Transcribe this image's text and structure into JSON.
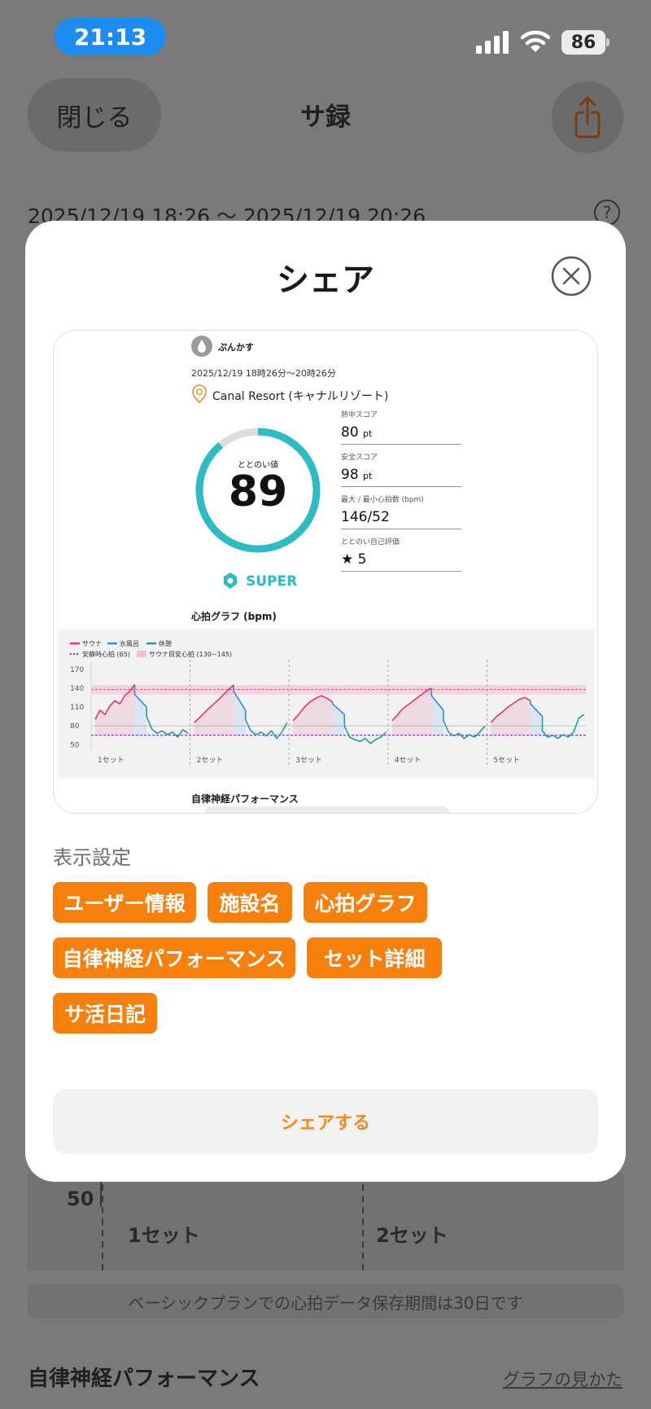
{
  "status_bar": {
    "time": "21:13",
    "battery": "86"
  },
  "nav": {
    "close_label": "閉じる",
    "title": "サ録",
    "share_icon": "share-icon"
  },
  "session": {
    "date_range": "2025/12/19 18:26 〜 2025/12/19 20:26",
    "help": "?"
  },
  "background": {
    "axis_50": "50",
    "set1": "1セット",
    "set2": "2セット",
    "notice": "ベーシックプランでの心拍データ保存期間は30日です",
    "section_title": "自律神経パフォーマンス",
    "graph_link": "グラフの見かた"
  },
  "modal": {
    "title": "シェア",
    "display_settings_label": "表示設定",
    "chips": [
      "ユーザー情報",
      "施設名",
      "心拍グラフ",
      "自律神経パフォーマンス",
      "セット詳細",
      "サ活日記"
    ],
    "share_button": "シェアする"
  },
  "preview": {
    "user_name": "ぷんかす",
    "date": "2025/12/19 18時26分〜20時26分",
    "facility": "Canal Resort (キャナルリゾート)",
    "totonoi_label": "ととのい値",
    "totonoi_value": "89",
    "totonoi_ring_fraction": 0.89,
    "grade": "SUPER",
    "metrics": [
      {
        "label": "熱中スコア",
        "value": "80",
        "unit": "pt"
      },
      {
        "label": "安全スコア",
        "value": "98",
        "unit": "pt"
      },
      {
        "label": "最大 / 最小心拍数 (bpm)",
        "value": "146/52",
        "unit": ""
      },
      {
        "label": "ととのい自己評価",
        "value": "★ 5",
        "unit": ""
      }
    ],
    "hr_graph_title": "心拍グラフ (bpm)",
    "ans_title": "自律神経パフォーマンス"
  },
  "chart_data": {
    "type": "line",
    "title": "心拍グラフ (bpm)",
    "ylabel": "bpm",
    "yticks": [
      170,
      140,
      110,
      80,
      50
    ],
    "ylim": [
      40,
      175
    ],
    "x_categories": [
      "1セット",
      "2セット",
      "3セット",
      "4セット",
      "5セット"
    ],
    "legend": [
      "サウナ",
      "水風呂",
      "休憩",
      "安静時心拍 (65)",
      "サウナ目安心拍 (130~145)"
    ],
    "colors": {
      "sauna": "#e8336b",
      "water": "#2e8be6",
      "rest": "#1aa19a",
      "resting_line": "#8a2be2",
      "target_band": "#f4a0b0"
    },
    "resting_hr": 65,
    "target_band": [
      130,
      145
    ],
    "sets": [
      {
        "name": "1セット",
        "sauna": [
          90,
          105,
          98,
          112,
          120,
          115,
          128,
          135,
          146
        ],
        "water": [
          130,
          110
        ],
        "rest": [
          95,
          75,
          68,
          72,
          66,
          70,
          62,
          74,
          68
        ]
      },
      {
        "name": "2セット",
        "sauna": [
          85,
          92,
          100,
          108,
          115,
          122,
          130,
          138,
          145
        ],
        "water": [
          135,
          105
        ],
        "rest": [
          90,
          72,
          66,
          70,
          64,
          72,
          60,
          70,
          85
        ]
      },
      {
        "name": "3セット",
        "sauna": [
          88,
          98,
          110,
          118,
          124,
          128,
          124,
          118
        ],
        "water": [
          115,
          98
        ],
        "rest": [
          80,
          62,
          58,
          55,
          60,
          52,
          58,
          62,
          70
        ]
      },
      {
        "name": "4セット",
        "sauna": [
          88,
          96,
          106,
          112,
          118,
          124,
          130,
          136,
          140
        ],
        "water": [
          128,
          105
        ],
        "rest": [
          88,
          70,
          64,
          68,
          60,
          66,
          62,
          70,
          80
        ]
      },
      {
        "name": "5セット",
        "sauna": [
          85,
          95,
          102,
          110,
          116,
          122,
          125,
          120
        ],
        "water": [
          115,
          95
        ],
        "rest": [
          72,
          62,
          65,
          60,
          66,
          62,
          70,
          92,
          98
        ]
      }
    ]
  }
}
